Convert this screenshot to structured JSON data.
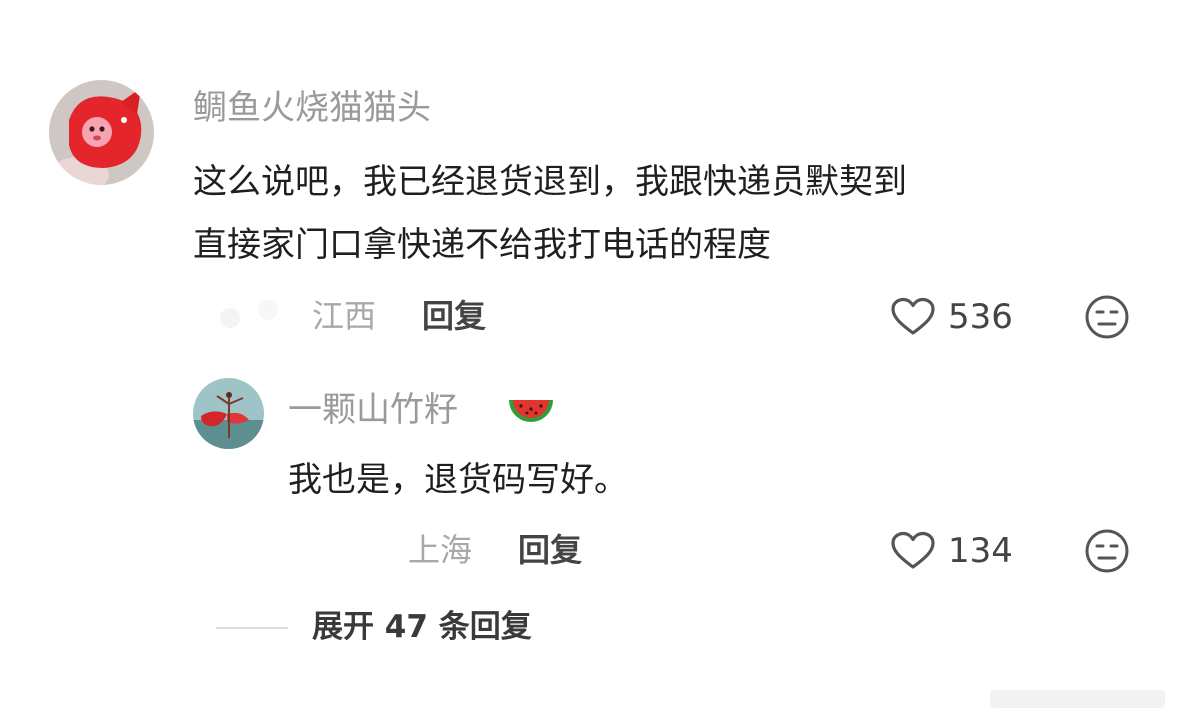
{
  "comment": {
    "username": "鲷鱼火烧猫猫头",
    "text_line1": "这么说吧，我已经退货退到，我跟快递员默契到",
    "text_line2": "直接家门口拿快递不给我打电话的程度",
    "location": "江西",
    "reply_label": "回复",
    "like_count": "536",
    "like_icon": "heart-outline-icon",
    "dislike_icon": "meh-face-icon"
  },
  "reply": {
    "username": "一颗山竹籽",
    "username_emoji": "watermelon-icon",
    "text": "我也是，退货码写好。",
    "location": "上海",
    "reply_label": "回复",
    "like_count": "134",
    "like_icon": "heart-outline-icon",
    "dislike_icon": "meh-face-icon"
  },
  "expand": {
    "label": "展开 47 条回复"
  },
  "colors": {
    "username": "#9a9a9a",
    "text": "#1f1f1f",
    "accent_red": "#e02a2a"
  }
}
